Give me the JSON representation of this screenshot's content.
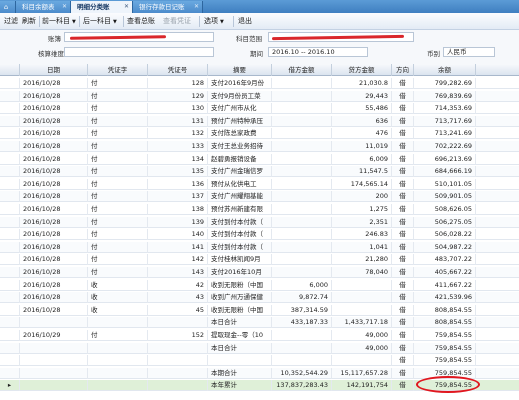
{
  "tabs": [
    {
      "label": "⌂",
      "active": false
    },
    {
      "label": "科目余额表",
      "active": false
    },
    {
      "label": "明细分类账",
      "active": true
    },
    {
      "label": "银行存款日记账",
      "active": false
    }
  ],
  "toolbar": {
    "filter": "过滤",
    "refresh": "刷新",
    "prev_account": "前一科目",
    "next_account": "后一科目",
    "view_ledger": "查看总账",
    "view_voucher": "查看凭证",
    "options": "选项",
    "exit": "退出"
  },
  "info": {
    "account_book_label": "账簿",
    "account_book_value": "",
    "account_range_label": "科目范围",
    "account_range_value": "",
    "aux_label": "核算维度",
    "period_label": "期间",
    "period_value": "2016.10 -- 2016.10",
    "currency_label": "币别",
    "currency_value": "人民币"
  },
  "columns": [
    "日期",
    "凭证字",
    "凭证号",
    "摘要",
    "借方金额",
    "贷方金额",
    "方向",
    "余额"
  ],
  "rows": [
    {
      "date": "2016/10/28",
      "word": "付",
      "no": "128",
      "summary": "支付2016年9月份",
      "debit": "",
      "credit": "21,030.8",
      "dir": "借",
      "balance": "799,282.69"
    },
    {
      "date": "2016/10/28",
      "word": "付",
      "no": "129",
      "summary": "支付9月份员工菜",
      "debit": "",
      "credit": "29,443",
      "dir": "借",
      "balance": "769,839.69"
    },
    {
      "date": "2016/10/28",
      "word": "付",
      "no": "130",
      "summary": "支付广州市从化",
      "debit": "",
      "credit": "55,486",
      "dir": "借",
      "balance": "714,353.69"
    },
    {
      "date": "2016/10/28",
      "word": "付",
      "no": "131",
      "summary": "预付广州特种承压",
      "debit": "",
      "credit": "636",
      "dir": "借",
      "balance": "713,717.69"
    },
    {
      "date": "2016/10/28",
      "word": "付",
      "no": "132",
      "summary": "支付陈总家政费",
      "debit": "",
      "credit": "476",
      "dir": "借",
      "balance": "713,241.69"
    },
    {
      "date": "2016/10/28",
      "word": "付",
      "no": "133",
      "summary": "支付王总业务招待",
      "debit": "",
      "credit": "11,019",
      "dir": "借",
      "balance": "702,222.69"
    },
    {
      "date": "2016/10/28",
      "word": "付",
      "no": "134",
      "summary": "赵碧勇报销设备",
      "debit": "",
      "credit": "6,009",
      "dir": "借",
      "balance": "696,213.69"
    },
    {
      "date": "2016/10/28",
      "word": "付",
      "no": "135",
      "summary": "支付广州金瑞信罗",
      "debit": "",
      "credit": "11,547.5",
      "dir": "借",
      "balance": "684,666.19"
    },
    {
      "date": "2016/10/28",
      "word": "付",
      "no": "136",
      "summary": "预付从化供电工",
      "debit": "",
      "credit": "174,565.14",
      "dir": "借",
      "balance": "510,101.05"
    },
    {
      "date": "2016/10/28",
      "word": "付",
      "no": "137",
      "summary": "支付广州耀翔基能",
      "debit": "",
      "credit": "200",
      "dir": "借",
      "balance": "509,901.05"
    },
    {
      "date": "2016/10/28",
      "word": "付",
      "no": "138",
      "summary": "预付苏州新建有限",
      "debit": "",
      "credit": "1,275",
      "dir": "借",
      "balance": "508,626.05"
    },
    {
      "date": "2016/10/28",
      "word": "付",
      "no": "139",
      "summary": "支付到付本付款（",
      "debit": "",
      "credit": "2,351",
      "dir": "借",
      "balance": "506,275.05"
    },
    {
      "date": "2016/10/28",
      "word": "付",
      "no": "140",
      "summary": "支付到付本付款（",
      "debit": "",
      "credit": "246.83",
      "dir": "借",
      "balance": "506,028.22"
    },
    {
      "date": "2016/10/28",
      "word": "付",
      "no": "141",
      "summary": "支付到付本付款（",
      "debit": "",
      "credit": "1,041",
      "dir": "借",
      "balance": "504,987.22"
    },
    {
      "date": "2016/10/28",
      "word": "付",
      "no": "142",
      "summary": "支付桂林凯闻9月",
      "debit": "",
      "credit": "21,280",
      "dir": "借",
      "balance": "483,707.22"
    },
    {
      "date": "2016/10/28",
      "word": "付",
      "no": "143",
      "summary": "支付2016年10月",
      "debit": "",
      "credit": "78,040",
      "dir": "借",
      "balance": "405,667.22"
    },
    {
      "date": "2016/10/28",
      "word": "收",
      "no": "42",
      "summary": "收到无限粉（中国",
      "debit": "6,000",
      "credit": "",
      "dir": "借",
      "balance": "411,667.22"
    },
    {
      "date": "2016/10/28",
      "word": "收",
      "no": "43",
      "summary": "收到广州万通保健",
      "debit": "9,872.74",
      "credit": "",
      "dir": "借",
      "balance": "421,539.96"
    },
    {
      "date": "2016/10/28",
      "word": "收",
      "no": "45",
      "summary": "收到无限粉（中国",
      "debit": "387,314.59",
      "credit": "",
      "dir": "借",
      "balance": "808,854.55"
    },
    {
      "date": "",
      "word": "",
      "no": "",
      "summary": "本日合计",
      "debit": "433,187.33",
      "credit": "1,433,717.18",
      "dir": "借",
      "balance": "808,854.55"
    },
    {
      "date": "2016/10/29",
      "word": "付",
      "no": "152",
      "summary": "提取现金--零（10",
      "debit": "",
      "credit": "49,000",
      "dir": "借",
      "balance": "759,854.55"
    },
    {
      "date": "",
      "word": "",
      "no": "",
      "summary": "本日合计",
      "debit": "",
      "credit": "49,000",
      "dir": "借",
      "balance": "759,854.55"
    },
    {
      "date": "",
      "word": "",
      "no": "",
      "summary": "",
      "debit": "",
      "credit": "",
      "dir": "借",
      "balance": "759,854.55"
    },
    {
      "date": "",
      "word": "",
      "no": "",
      "summary": "本期合计",
      "debit": "10,352,544.29",
      "credit": "15,117,657.28",
      "dir": "借",
      "balance": "759,854.55"
    },
    {
      "date": "",
      "word": "",
      "no": "",
      "summary": "本年累计",
      "debit": "137,837,283.43",
      "credit": "142,191,754",
      "dir": "借",
      "balance": "759,854.55"
    }
  ]
}
